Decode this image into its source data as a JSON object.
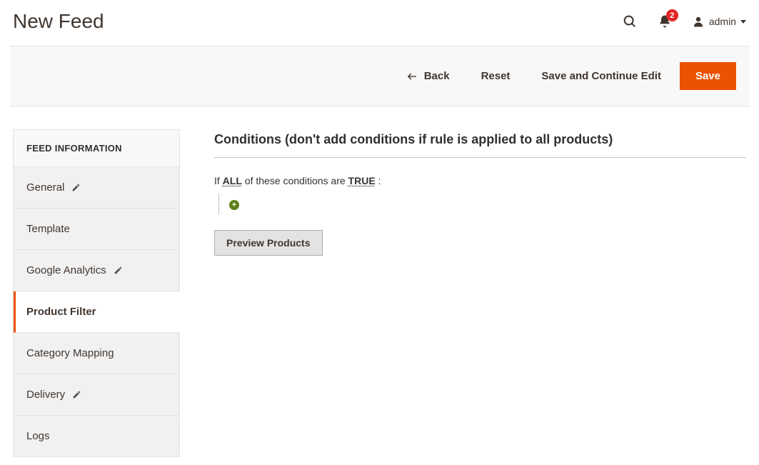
{
  "page": {
    "title": "New Feed"
  },
  "header": {
    "notifications_count": "2",
    "user_label": "admin"
  },
  "toolbar": {
    "back": "Back",
    "reset": "Reset",
    "save_continue": "Save and Continue Edit",
    "save": "Save"
  },
  "sidebar": {
    "header": "FEED INFORMATION",
    "items": [
      {
        "label": "General",
        "editable": true,
        "active": false
      },
      {
        "label": "Template",
        "editable": false,
        "active": false
      },
      {
        "label": "Google Analytics",
        "editable": true,
        "active": false
      },
      {
        "label": "Product Filter",
        "editable": false,
        "active": true
      },
      {
        "label": "Category Mapping",
        "editable": false,
        "active": false
      },
      {
        "label": "Delivery",
        "editable": true,
        "active": false
      },
      {
        "label": "Logs",
        "editable": false,
        "active": false
      }
    ]
  },
  "main": {
    "section_title": "Conditions (don't add conditions if rule is applied to all products)",
    "condition_prefix": "If ",
    "condition_all": "ALL",
    "condition_mid": " of these conditions are ",
    "condition_true": "TRUE",
    "condition_suffix": " :",
    "preview_button": "Preview Products"
  }
}
